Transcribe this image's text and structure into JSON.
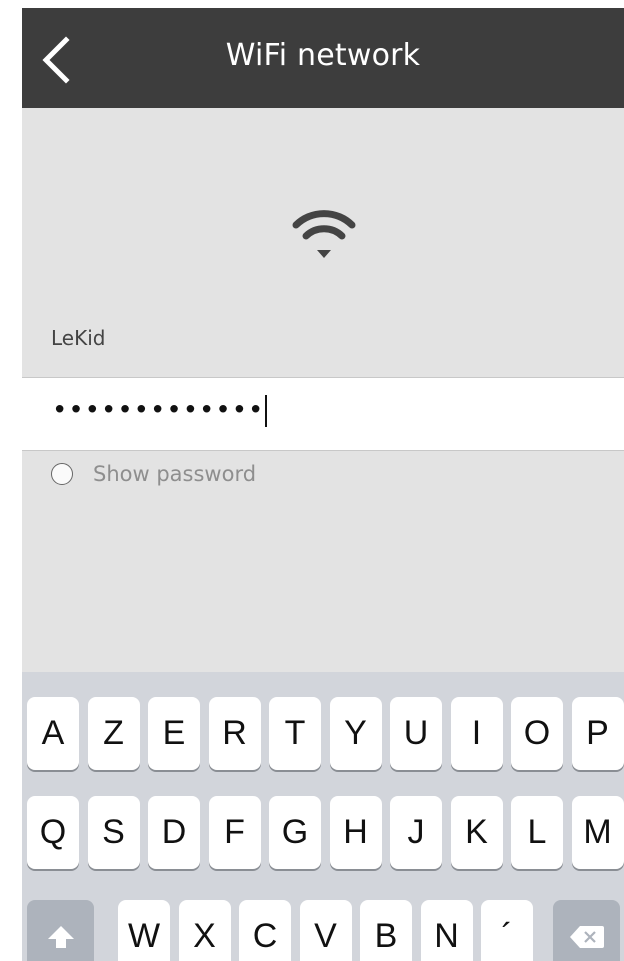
{
  "header": {
    "title": "WiFi network"
  },
  "network": {
    "ssid": "LeKid"
  },
  "password": {
    "masked_value": "•••••••••••••"
  },
  "show_password": {
    "label": "Show password",
    "checked": false
  },
  "keyboard": {
    "row1": [
      "A",
      "Z",
      "E",
      "R",
      "T",
      "Y",
      "U",
      "I",
      "O",
      "P"
    ],
    "row2": [
      "Q",
      "S",
      "D",
      "F",
      "G",
      "H",
      "J",
      "K",
      "L",
      "M"
    ],
    "row3": [
      "W",
      "X",
      "C",
      "V",
      "B",
      "N",
      "´"
    ]
  },
  "colors": {
    "header_bg": "#3d3d3d",
    "screen_bg": "#e3e3e3",
    "keyboard_bg": "#d2d5db"
  }
}
